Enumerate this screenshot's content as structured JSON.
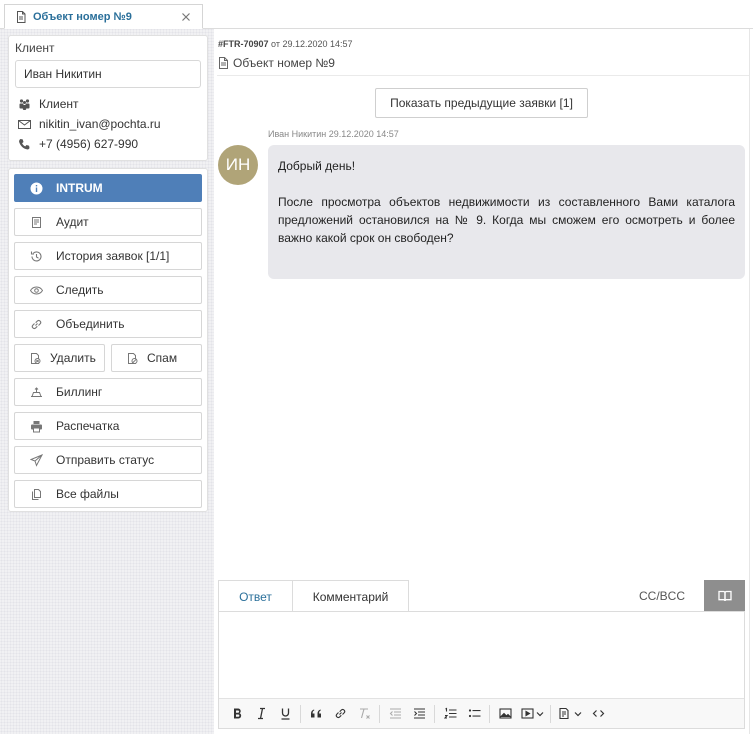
{
  "tab": {
    "title": "Объект номер №9"
  },
  "client": {
    "section_label": "Клиент",
    "name": "Иван Никитин",
    "type": "Клиент",
    "email": "nikitin_ivan@pochta.ru",
    "phone": "+7 (4956) 627-990"
  },
  "actions": {
    "intrum": "INTRUM",
    "audit": "Аудит",
    "history": "История заявок [1/1]",
    "follow": "Следить",
    "merge": "Объединить",
    "delete": "Удалить",
    "spam": "Спам",
    "billing": "Биллинг",
    "print": "Распечатка",
    "send_status": "Отправить статус",
    "all_files": "Все файлы"
  },
  "ticket": {
    "id": "#FTR-70907",
    "from_word": "от",
    "date": "29.12.2020 14:57",
    "subject": "Объект номер №9"
  },
  "show_previous": "Показать предыдущие заявки [1]",
  "message": {
    "meta": "Иван Никитин 29.12.2020 14:57",
    "avatar_initials": "ИН",
    "greeting": "Добрый день!",
    "body": "После просмотра объектов недвижимости из составленного Вами каталога предложений остановился на № 9. Когда мы сможем его осмотреть и более важно какой срок он свободен?"
  },
  "reply": {
    "tab_answer": "Ответ",
    "tab_comment": "Комментарий",
    "cc_bcc": "CC/BCC"
  },
  "colors": {
    "primary": "#4f7fb8",
    "link": "#2a6f9a",
    "avatar": "#b0a478",
    "bubble": "#e8e8ec"
  }
}
